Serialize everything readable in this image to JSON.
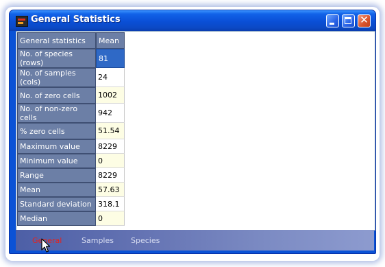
{
  "window": {
    "title": "General Statistics",
    "controls": {
      "minimize": "minimize",
      "maximize": "maximize",
      "close": "close"
    }
  },
  "table": {
    "header": {
      "label": "General statistics",
      "value": "Mean"
    },
    "rows": [
      {
        "label": "No. of species (rows)",
        "value": "81",
        "selected": true
      },
      {
        "label": "No. of samples (cols)",
        "value": "24"
      },
      {
        "label": "No. of zero cells",
        "value": "1002"
      },
      {
        "label": "No. of non-zero cells",
        "value": "942"
      },
      {
        "label": "% zero cells",
        "value": "51.54"
      },
      {
        "label": "Maximum value",
        "value": "8229"
      },
      {
        "label": "Minimum value",
        "value": "0"
      },
      {
        "label": "Range",
        "value": "8229"
      },
      {
        "label": "Mean",
        "value": "57.63"
      },
      {
        "label": "Standard deviation",
        "value": "318.1"
      },
      {
        "label": "Median",
        "value": "0"
      }
    ]
  },
  "tabs": [
    {
      "label": "General",
      "active": true
    },
    {
      "label": "Samples",
      "active": false
    },
    {
      "label": "Species",
      "active": false
    }
  ],
  "colors": {
    "titlebar": "#0a52d6",
    "header_cell": "#6c7fa6",
    "selected_cell": "#2f69c6",
    "cream_cell": "#fdfde4",
    "active_tab": "#e8211a"
  }
}
